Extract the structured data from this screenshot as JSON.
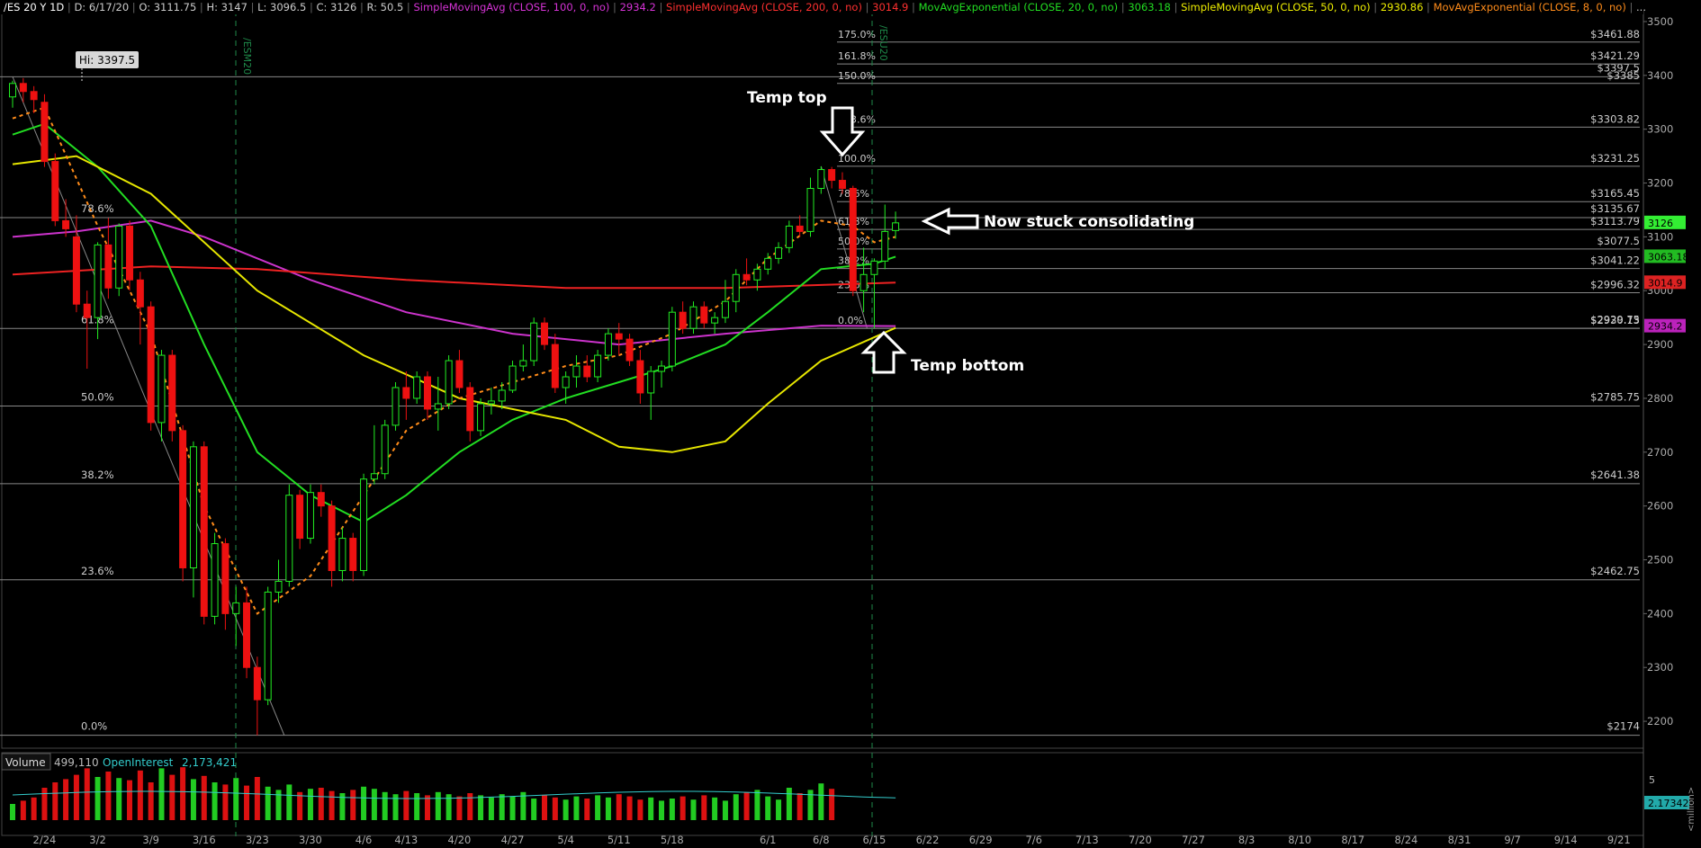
{
  "header": {
    "symbol": "/ES 20 Y 1D",
    "items": [
      {
        "text": "D: 6/17/20",
        "color": "#cccccc"
      },
      {
        "text": "O: 3111.75",
        "color": "#cccccc"
      },
      {
        "text": "H: 3147",
        "color": "#cccccc"
      },
      {
        "text": "L: 3096.5",
        "color": "#cccccc"
      },
      {
        "text": "C: 3126",
        "color": "#cccccc"
      },
      {
        "text": "R: 50.5",
        "color": "#cccccc"
      },
      {
        "text": "SimpleMovingAvg (CLOSE, 100, 0, no)",
        "color": "#d633d6"
      },
      {
        "text": "2934.2",
        "color": "#d633d6"
      },
      {
        "text": "SimpleMovingAvg (CLOSE, 200, 0, no)",
        "color": "#ff3030"
      },
      {
        "text": "3014.9",
        "color": "#ff3030"
      },
      {
        "text": "MovAvgExponential (CLOSE, 20, 0, no)",
        "color": "#22dd22"
      },
      {
        "text": "3063.18",
        "color": "#22dd22"
      },
      {
        "text": "SimpleMovingAvg (CLOSE, 50, 0, no)",
        "color": "#eeee00"
      },
      {
        "text": "2930.86",
        "color": "#eeee00"
      },
      {
        "text": "MovAvgExponential (CLOSE, 8, 0, no)",
        "color": "#ff8c1a"
      },
      {
        "text": "..."
      }
    ]
  },
  "hi_label": "Hi: 3397.5",
  "contract_labels": [
    "/ESM20",
    "/ESU20"
  ],
  "annotations": {
    "temp_top": "Temp top",
    "temp_bottom": "Temp bottom",
    "consolidating": "Now stuck consolidating"
  },
  "volume_panel": {
    "label": "Volume",
    "value": "499,110",
    "oi_label": "OpenInterest",
    "oi_value": "2,173,421",
    "oi_axis_value": "2.17342",
    "axis_tick": "5",
    "units": "<million>"
  },
  "price_tags": [
    {
      "text": "3126",
      "value": 3126,
      "color": "#33ee33"
    },
    {
      "text": "3063.18",
      "value": 3063.18,
      "color": "#22bb22"
    },
    {
      "text": "3014.9",
      "value": 3014.9,
      "color": "#dd2222"
    },
    {
      "text": "2934.2",
      "value": 2934.2,
      "color": "#bb22bb"
    }
  ],
  "colors": {
    "up": "#22ee22",
    "down": "#ee1111",
    "grid": "#777777",
    "text": "#bbbbbb",
    "annotation": "#ffffff"
  },
  "chart_data": {
    "type": "candlestick",
    "title": "/ES 20 Y 1D",
    "ylim": [
      2150,
      3520
    ],
    "y_ticks": [
      2200,
      2300,
      2400,
      2500,
      2600,
      2700,
      2800,
      2900,
      3000,
      3100,
      3200,
      3300,
      3400,
      3500
    ],
    "x_ticks": [
      "2/24",
      "3/2",
      "3/9",
      "3/16",
      "3/23",
      "3/30",
      "4/6",
      "4/13",
      "4/20",
      "4/27",
      "5/4",
      "5/11",
      "5/18",
      "6/1",
      "6/8",
      "6/15",
      "6/22",
      "6/29",
      "7/6",
      "7/13",
      "7/20",
      "7/27",
      "8/3",
      "8/10",
      "8/17",
      "8/24",
      "8/31",
      "9/7",
      "9/14",
      "9/21"
    ],
    "fib_large": [
      {
        "label": "0.0%",
        "value": 2174,
        "price": "$2174"
      },
      {
        "label": "23.6%",
        "value": 2462.75,
        "price": "$2462.75"
      },
      {
        "label": "38.2%",
        "value": 2641.38,
        "price": "$2641.38"
      },
      {
        "label": "50.0%",
        "value": 2785.75,
        "price": "$2785.75"
      },
      {
        "label": "61.8%",
        "value": 2929.75,
        "price": "$2929.75"
      },
      {
        "label": "78.6%",
        "value": 3135.67,
        "price": "$3135.67"
      },
      {
        "label": "",
        "value": 3397.5,
        "price": "$3397.5"
      }
    ],
    "fib_small": [
      {
        "label": "0.0%",
        "value": 2930.13,
        "price": "$2930.13"
      },
      {
        "label": "23.6%",
        "value": 2996.32,
        "price": "$2996.32"
      },
      {
        "label": "38.2%",
        "value": 3041.22,
        "price": "$3041.22"
      },
      {
        "label": "50.0%",
        "value": 3077.5,
        "price": "$3077.5"
      },
      {
        "label": "61.8%",
        "value": 3113.79,
        "price": "$3113.79"
      },
      {
        "label": "78.6%",
        "value": 3165.45,
        "price": "$3165.45"
      },
      {
        "label": "100.0%",
        "value": 3231.25,
        "price": "$3231.25"
      },
      {
        "label": "123.6%",
        "value": 3303.82,
        "price": "$3303.82"
      },
      {
        "label": "150.0%",
        "value": 3385,
        "price": "$3385"
      },
      {
        "label": "161.8%",
        "value": 3421.29,
        "price": "$3421.29"
      },
      {
        "label": "175.0%",
        "value": 3461.88,
        "price": "$3461.88"
      }
    ],
    "candles": [
      [
        "2/19",
        3360,
        3390,
        3340,
        3385
      ],
      [
        "2/20",
        3385,
        3395,
        3350,
        3370
      ],
      [
        "2/21",
        3370,
        3380,
        3330,
        3355
      ],
      [
        "2/24",
        3350,
        3365,
        3230,
        3240
      ],
      [
        "2/25",
        3240,
        3255,
        3120,
        3130
      ],
      [
        "2/26",
        3130,
        3170,
        3100,
        3115
      ],
      [
        "2/27",
        3100,
        3140,
        2960,
        2975
      ],
      [
        "2/28",
        2975,
        3000,
        2855,
        2950
      ],
      [
        "3/2",
        2950,
        3090,
        2910,
        3085
      ],
      [
        "3/3",
        3085,
        3135,
        2985,
        3005
      ],
      [
        "3/4",
        3005,
        3125,
        2990,
        3120
      ],
      [
        "3/5",
        3120,
        3130,
        3000,
        3020
      ],
      [
        "3/6",
        3020,
        3035,
        2900,
        2970
      ],
      [
        "3/9",
        2970,
        2980,
        2740,
        2755
      ],
      [
        "3/10",
        2755,
        2890,
        2720,
        2880
      ],
      [
        "3/11",
        2880,
        2890,
        2720,
        2740
      ],
      [
        "3/12",
        2740,
        2750,
        2460,
        2485
      ],
      [
        "3/13",
        2485,
        2720,
        2430,
        2710
      ],
      [
        "3/16",
        2710,
        2720,
        2380,
        2395
      ],
      [
        "3/17",
        2395,
        2550,
        2380,
        2530
      ],
      [
        "3/18",
        2530,
        2540,
        2370,
        2400
      ],
      [
        "3/19",
        2400,
        2450,
        2340,
        2420
      ],
      [
        "3/20",
        2420,
        2450,
        2280,
        2300
      ],
      [
        "3/23",
        2300,
        2320,
        2174,
        2240
      ],
      [
        "3/24",
        2240,
        2450,
        2230,
        2440
      ],
      [
        "3/25",
        2440,
        2500,
        2420,
        2460
      ],
      [
        "3/26",
        2460,
        2640,
        2450,
        2620
      ],
      [
        "3/27",
        2620,
        2630,
        2520,
        2540
      ],
      [
        "3/30",
        2540,
        2640,
        2530,
        2625
      ],
      [
        "3/31",
        2625,
        2640,
        2580,
        2600
      ],
      [
        "4/1",
        2600,
        2610,
        2450,
        2480
      ],
      [
        "4/2",
        2480,
        2560,
        2460,
        2540
      ],
      [
        "4/3",
        2540,
        2550,
        2460,
        2480
      ],
      [
        "4/6",
        2480,
        2660,
        2470,
        2650
      ],
      [
        "4/7",
        2650,
        2750,
        2640,
        2660
      ],
      [
        "4/8",
        2660,
        2760,
        2650,
        2750
      ],
      [
        "4/9",
        2750,
        2830,
        2740,
        2820
      ],
      [
        "4/13",
        2820,
        2850,
        2760,
        2800
      ],
      [
        "4/14",
        2800,
        2850,
        2790,
        2840
      ],
      [
        "4/15",
        2840,
        2850,
        2760,
        2780
      ],
      [
        "4/16",
        2780,
        2840,
        2740,
        2790
      ],
      [
        "4/17",
        2790,
        2880,
        2780,
        2870
      ],
      [
        "4/20",
        2870,
        2890,
        2810,
        2820
      ],
      [
        "4/21",
        2820,
        2830,
        2720,
        2740
      ],
      [
        "4/22",
        2740,
        2800,
        2730,
        2790
      ],
      [
        "4/23",
        2790,
        2820,
        2770,
        2795
      ],
      [
        "4/24",
        2795,
        2830,
        2780,
        2815
      ],
      [
        "4/27",
        2815,
        2870,
        2810,
        2860
      ],
      [
        "4/28",
        2860,
        2900,
        2850,
        2870
      ],
      [
        "4/29",
        2870,
        2950,
        2860,
        2940
      ],
      [
        "4/30",
        2940,
        2950,
        2890,
        2900
      ],
      [
        "5/1",
        2900,
        2920,
        2810,
        2820
      ],
      [
        "5/4",
        2820,
        2850,
        2790,
        2840
      ],
      [
        "5/5",
        2840,
        2880,
        2820,
        2860
      ],
      [
        "5/6",
        2860,
        2880,
        2830,
        2840
      ],
      [
        "5/7",
        2840,
        2890,
        2830,
        2880
      ],
      [
        "5/8",
        2880,
        2930,
        2870,
        2920
      ],
      [
        "5/11",
        2920,
        2940,
        2880,
        2910
      ],
      [
        "5/12",
        2910,
        2920,
        2860,
        2870
      ],
      [
        "5/13",
        2870,
        2890,
        2790,
        2810
      ],
      [
        "5/14",
        2810,
        2860,
        2760,
        2850
      ],
      [
        "5/15",
        2850,
        2870,
        2820,
        2860
      ],
      [
        "5/18",
        2860,
        2970,
        2850,
        2960
      ],
      [
        "5/19",
        2960,
        2980,
        2920,
        2930
      ],
      [
        "5/20",
        2930,
        2980,
        2920,
        2970
      ],
      [
        "5/21",
        2970,
        2980,
        2930,
        2940
      ],
      [
        "5/22",
        2940,
        2960,
        2920,
        2950
      ],
      [
        "5/26",
        2950,
        3020,
        2940,
        2980
      ],
      [
        "5/27",
        2980,
        3040,
        2960,
        3030
      ],
      [
        "5/28",
        3030,
        3060,
        3010,
        3020
      ],
      [
        "5/29",
        3020,
        3050,
        3000,
        3040
      ],
      [
        "6/1",
        3040,
        3070,
        3030,
        3060
      ],
      [
        "6/2",
        3060,
        3090,
        3050,
        3080
      ],
      [
        "6/3",
        3080,
        3130,
        3070,
        3120
      ],
      [
        "6/4",
        3120,
        3140,
        3100,
        3110
      ],
      [
        "6/5",
        3110,
        3210,
        3100,
        3190
      ],
      [
        "6/8",
        3190,
        3231,
        3180,
        3225
      ],
      [
        "6/9",
        3225,
        3230,
        3190,
        3205
      ],
      [
        "6/10",
        3205,
        3220,
        3180,
        3190
      ],
      [
        "6/11",
        3190,
        3195,
        2990,
        3000
      ],
      [
        "6/12",
        3000,
        3080,
        2960,
        3030
      ],
      [
        "6/15",
        3030,
        3060,
        2930,
        3055
      ],
      [
        "6/16",
        3055,
        3160,
        3040,
        3110
      ],
      [
        "6/17",
        3111.75,
        3147,
        3096.5,
        3126
      ]
    ],
    "volume": [
      1.5,
      1.8,
      2.1,
      3.0,
      3.5,
      3.8,
      4.2,
      4.8,
      4.0,
      4.5,
      3.9,
      3.7,
      4.6,
      3.5,
      4.8,
      4.2,
      4.9,
      3.8,
      4.1,
      3.5,
      3.3,
      3.9,
      3.2,
      4.0,
      3.1,
      2.8,
      3.3,
      2.6,
      2.9,
      3.0,
      2.7,
      2.5,
      2.8,
      3.1,
      2.9,
      2.6,
      2.4,
      2.7,
      2.5,
      2.3,
      2.6,
      2.4,
      2.2,
      2.5,
      2.3,
      2.1,
      2.4,
      2.2,
      2.6,
      2.0,
      2.3,
      2.1,
      1.9,
      2.2,
      2.0,
      2.3,
      2.1,
      2.4,
      2.2,
      1.9,
      2.1,
      1.8,
      2.0,
      2.2,
      1.9,
      2.3,
      2.1,
      1.8,
      2.4,
      2.6,
      2.8,
      2.2,
      1.9,
      3.0,
      2.5,
      2.8,
      3.4,
      2.9
    ],
    "series": [
      {
        "name": "SimpleMovingAvg (CLOSE, 100, 0, no)",
        "color": "#cc33cc",
        "points": [
          [
            "2/19",
            3100
          ],
          [
            "2/27",
            3110
          ],
          [
            "3/9",
            3130
          ],
          [
            "3/16",
            3100
          ],
          [
            "3/30",
            3020
          ],
          [
            "4/13",
            2960
          ],
          [
            "4/27",
            2920
          ],
          [
            "5/11",
            2900
          ],
          [
            "5/26",
            2920
          ],
          [
            "6/8",
            2935
          ],
          [
            "6/17",
            2934.2
          ]
        ]
      },
      {
        "name": "SimpleMovingAvg (CLOSE, 200, 0, no)",
        "color": "#ee2222",
        "points": [
          [
            "2/19",
            3030
          ],
          [
            "3/9",
            3045
          ],
          [
            "3/23",
            3040
          ],
          [
            "4/13",
            3020
          ],
          [
            "5/4",
            3005
          ],
          [
            "5/26",
            3005
          ],
          [
            "6/17",
            3014.9
          ]
        ]
      },
      {
        "name": "MovAvgExponential (CLOSE, 20, 0, no)",
        "color": "#22dd22",
        "points": [
          [
            "2/19",
            3290
          ],
          [
            "2/24",
            3310
          ],
          [
            "3/2",
            3230
          ],
          [
            "3/9",
            3120
          ],
          [
            "3/16",
            2900
          ],
          [
            "3/23",
            2700
          ],
          [
            "3/30",
            2620
          ],
          [
            "4/6",
            2570
          ],
          [
            "4/13",
            2620
          ],
          [
            "4/20",
            2700
          ],
          [
            "4/27",
            2760
          ],
          [
            "5/4",
            2800
          ],
          [
            "5/11",
            2830
          ],
          [
            "5/18",
            2860
          ],
          [
            "5/26",
            2900
          ],
          [
            "6/1",
            2960
          ],
          [
            "6/8",
            3040
          ],
          [
            "6/15",
            3050
          ],
          [
            "6/17",
            3063.18
          ]
        ]
      },
      {
        "name": "SimpleMovingAvg (CLOSE, 50, 0, no)",
        "color": "#e6e600",
        "points": [
          [
            "2/19",
            3235
          ],
          [
            "2/27",
            3250
          ],
          [
            "3/9",
            3180
          ],
          [
            "3/23",
            3000
          ],
          [
            "4/6",
            2880
          ],
          [
            "4/20",
            2800
          ],
          [
            "5/4",
            2760
          ],
          [
            "5/11",
            2710
          ],
          [
            "5/18",
            2700
          ],
          [
            "5/26",
            2720
          ],
          [
            "6/1",
            2790
          ],
          [
            "6/8",
            2870
          ],
          [
            "6/17",
            2930.86
          ]
        ]
      },
      {
        "name": "MovAvgExponential (CLOSE, 8, 0, no)",
        "color": "#ff8c1a",
        "dashed": true,
        "points": [
          [
            "2/19",
            3320
          ],
          [
            "2/24",
            3340
          ],
          [
            "3/2",
            3120
          ],
          [
            "3/9",
            2920
          ],
          [
            "3/16",
            2600
          ],
          [
            "3/23",
            2400
          ],
          [
            "3/30",
            2470
          ],
          [
            "4/6",
            2620
          ],
          [
            "4/13",
            2740
          ],
          [
            "4/20",
            2800
          ],
          [
            "4/27",
            2830
          ],
          [
            "5/4",
            2860
          ],
          [
            "5/11",
            2880
          ],
          [
            "5/18",
            2920
          ],
          [
            "5/26",
            2980
          ],
          [
            "6/1",
            3060
          ],
          [
            "6/8",
            3130
          ],
          [
            "6/11",
            3120
          ],
          [
            "6/15",
            3090
          ],
          [
            "6/17",
            3100
          ]
        ]
      }
    ]
  }
}
